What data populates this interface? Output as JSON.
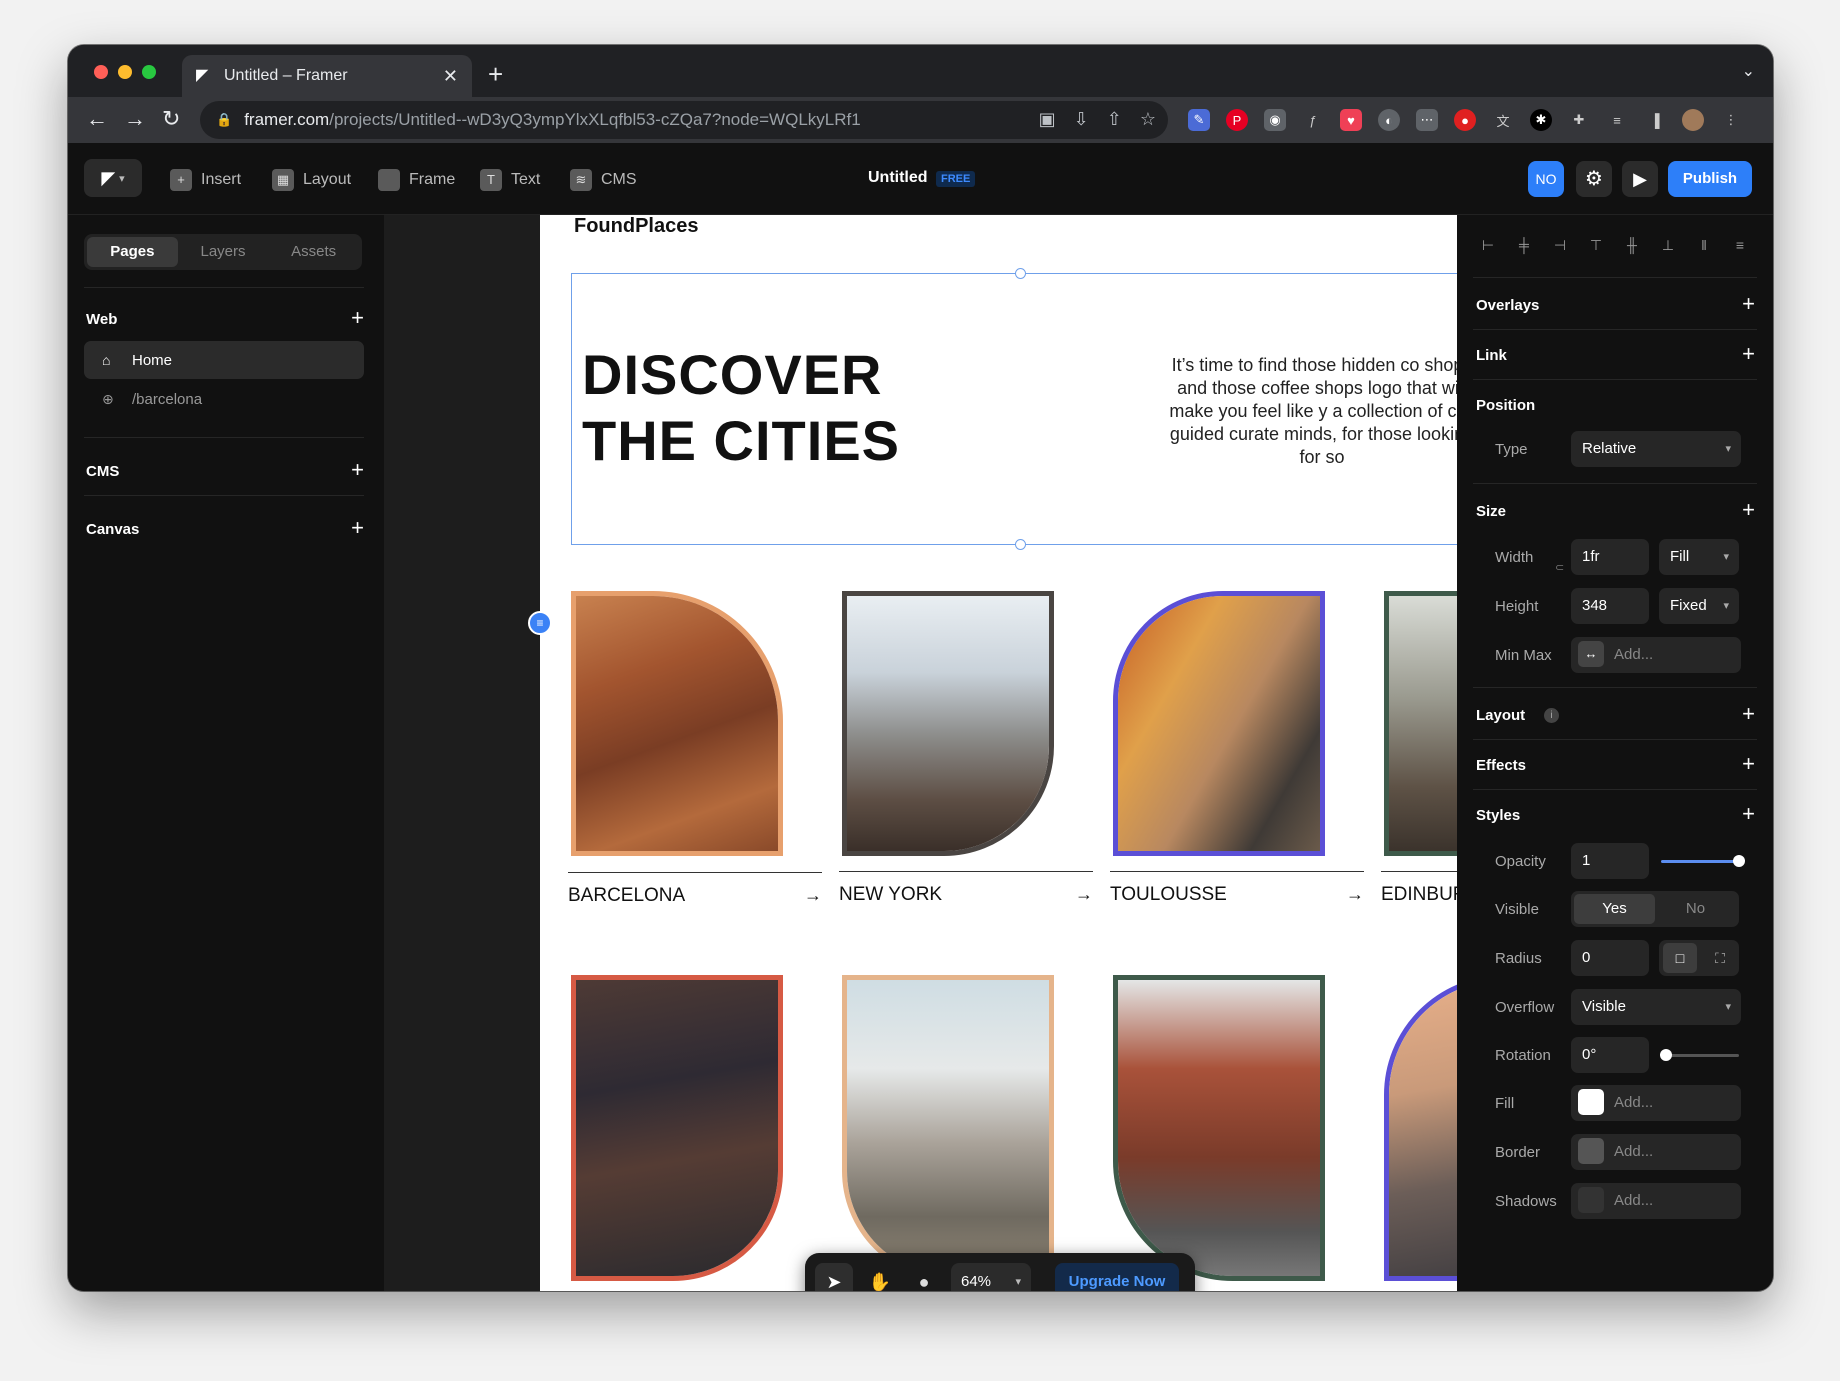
{
  "browser": {
    "tab_title": "Untitled – Framer",
    "url_domain": "framer.com",
    "url_path": "/projects/Untitled--wD3yQ3ympYlxXLqfbl53-cZQa7?node=WQLkyLRf1"
  },
  "topbar": {
    "insert": "Insert",
    "layout": "Layout",
    "frame": "Frame",
    "text": "Text",
    "cms": "CMS",
    "project_title": "Untitled",
    "plan_badge": "FREE",
    "avatar_initials": "NO",
    "publish": "Publish"
  },
  "left_panel": {
    "tabs": [
      "Pages",
      "Layers",
      "Assets"
    ],
    "web_section": "Web",
    "pages": [
      {
        "label": "Home",
        "icon": "home-icon"
      },
      {
        "label": "/barcelona",
        "icon": "globe-icon"
      }
    ],
    "cms_section": "CMS",
    "canvas_section": "Canvas"
  },
  "canvas": {
    "brand": "FoundPlaces",
    "hero_title_line1": "DISCOVER",
    "hero_title_line2": "THE CITIES",
    "hero_text": "It’s time to find those hidden co shops and those coffee shops logo that will make you feel like y a collection of city guided curate minds, for those looking for so",
    "cities": [
      {
        "name": "BARCELONA",
        "border": "#e7a06d"
      },
      {
        "name": "NEW YORK",
        "border": "#4a4542"
      },
      {
        "name": "TOULOUSSE",
        "border": "#5b4fd6"
      },
      {
        "name": "EDINBUR",
        "border": "#3e5a4a"
      }
    ],
    "second_row_borders": [
      "#d65a44",
      "#e5b48b",
      "#3e5a4a",
      "#5b4fd6"
    ],
    "zoom": "64%",
    "upgrade": "Upgrade Now"
  },
  "right_panel": {
    "overlays": "Overlays",
    "link": "Link",
    "position": "Position",
    "type_label": "Type",
    "type_value": "Relative",
    "size": "Size",
    "width_label": "Width",
    "width_value": "1fr",
    "width_mode": "Fill",
    "height_label": "Height",
    "height_value": "348",
    "height_mode": "Fixed",
    "minmax_label": "Min Max",
    "minmax_value": "Add...",
    "layout": "Layout",
    "effects": "Effects",
    "styles": "Styles",
    "opacity_label": "Opacity",
    "opacity_value": "1",
    "visible_label": "Visible",
    "visible_yes": "Yes",
    "visible_no": "No",
    "radius_label": "Radius",
    "radius_value": "0",
    "overflow_label": "Overflow",
    "overflow_value": "Visible",
    "rotation_label": "Rotation",
    "rotation_value": "0°",
    "fill_label": "Fill",
    "fill_value": "Add...",
    "border_label": "Border",
    "border_value": "Add...",
    "shadows_label": "Shadows",
    "shadows_value": "Add..."
  }
}
